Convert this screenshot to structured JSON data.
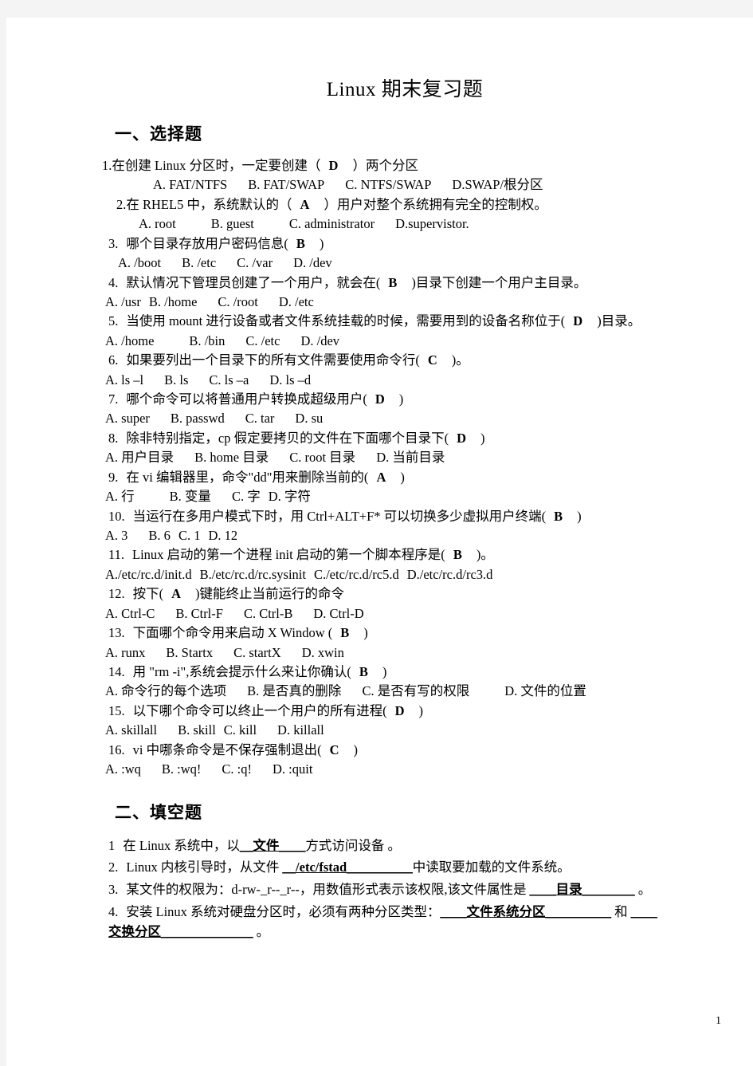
{
  "document": {
    "title": "Linux  期末复习题",
    "page_number": "1"
  },
  "sections": [
    {
      "heading": "一、选择题"
    },
    {
      "heading": "二、填空题"
    }
  ],
  "multiple_choice": [
    {
      "num": "1.",
      "stem_before": "在创建 Linux 分区时，一定要创建（",
      "answer": "D",
      "stem_after": "）两个分区",
      "options": [
        "A. FAT/NTFS",
        "B. FAT/SWAP",
        "C. NTFS/SWAP",
        "D.SWAP/根分区"
      ]
    },
    {
      "num": "2.",
      "stem_before": "在 RHEL5 中，系统默认的（",
      "answer": "A",
      "stem_after": "）用户对整个系统拥有完全的控制权。",
      "options": [
        "A. root",
        "B. guest",
        "C. administrator",
        "D.supervistor."
      ]
    },
    {
      "num": "3.",
      "stem_before": "哪个目录存放用户密码信息(",
      "answer": "B",
      "stem_after": ")",
      "options": [
        "A. /boot",
        "B. /etc",
        "C. /var",
        "D. /dev"
      ]
    },
    {
      "num": "4.",
      "stem_before": "默认情况下管理员创建了一个用户，就会在(",
      "answer": "B",
      "stem_after": ")目录下创建一个用户主目录。",
      "options": [
        "A. /usr",
        "B. /home",
        "C. /root",
        "D. /etc"
      ]
    },
    {
      "num": "5.",
      "stem_before": "当使用 mount 进行设备或者文件系统挂载的时候，需要用到的设备名称位于(",
      "answer": "D",
      "stem_after": ")目录。",
      "options": [
        "A. /home",
        "B. /bin",
        "C. /etc",
        "D. /dev"
      ]
    },
    {
      "num": "6.",
      "stem_before": "如果要列出一个目录下的所有文件需要使用命令行(",
      "answer": "C",
      "stem_after": ")。",
      "options": [
        "A. ls –l",
        "B. ls",
        "C. ls –a",
        "D. ls –d"
      ]
    },
    {
      "num": "7.",
      "stem_before": "哪个命令可以将普通用户转换成超级用户(",
      "answer": "D",
      "stem_after": ")",
      "options": [
        "A. super",
        "B. passwd",
        "C. tar",
        "D. su"
      ]
    },
    {
      "num": "8.",
      "stem_before": "除非特别指定，cp 假定要拷贝的文件在下面哪个目录下(",
      "answer": "D",
      "stem_after": ")",
      "options": [
        "A. 用户目录",
        "B. home 目录",
        "C. root 目录",
        "D. 当前目录"
      ]
    },
    {
      "num": "9.",
      "stem_before": "在 vi 编辑器里，命令\"dd\"用来删除当前的(",
      "answer": "A",
      "stem_after": ")",
      "options": [
        "A. 行",
        "B. 变量",
        "C. 字",
        "D. 字符"
      ]
    },
    {
      "num": "10.",
      "stem_before": "当运行在多用户模式下时，用 Ctrl+ALT+F* 可以切换多少虚拟用户终端(",
      "answer": "B",
      "stem_after": ")",
      "options": [
        "A. 3",
        "B. 6",
        "C. 1",
        "D. 12"
      ]
    },
    {
      "num": "11.",
      "stem_before": "Linux 启动的第一个进程 init 启动的第一个脚本程序是(",
      "answer": "B",
      "stem_after": ")。",
      "options": [
        "A./etc/rc.d/init.d",
        "B./etc/rc.d/rc.sysinit",
        "C./etc/rc.d/rc5.d",
        "D./etc/rc.d/rc3.d"
      ]
    },
    {
      "num": "12.",
      "stem_before": "按下(",
      "answer": "A",
      "stem_after": ")键能终止当前运行的命令",
      "options": [
        "A. Ctrl-C",
        "B. Ctrl-F",
        "C. Ctrl-B",
        "D. Ctrl-D"
      ]
    },
    {
      "num": "13.",
      "stem_before": "下面哪个命令用来启动 X Window (",
      "answer": "B",
      "stem_after": ")",
      "options": [
        "A. runx",
        "B. Startx",
        "C. startX",
        "D. xwin"
      ]
    },
    {
      "num": "14.",
      "stem_before": "用 \"rm -i\",系统会提示什么来让你确认(",
      "answer": "B",
      "stem_after": ")",
      "options": [
        "A. 命令行的每个选项",
        "B. 是否真的删除",
        "C. 是否有写的权限",
        "D. 文件的位置"
      ]
    },
    {
      "num": "15.",
      "stem_before": "以下哪个命令可以终止一个用户的所有进程(",
      "answer": "D",
      "stem_after": ")",
      "options": [
        "A. skillall",
        "B. skill",
        "C. kill",
        "D. killall"
      ]
    },
    {
      "num": "16.",
      "stem_before": "vi 中哪条命令是不保存强制退出(",
      "answer": "C",
      "stem_after": ")",
      "options": [
        "A. :wq",
        "B. :wq!",
        "C. :q!",
        "D. :quit"
      ]
    }
  ],
  "fill_in_blanks": [
    {
      "num": "1",
      "before": "在 Linux 系统中，以",
      "blank": "＿文件＿＿",
      "after": "方式访问设备 。"
    },
    {
      "num": "2.",
      "before": "Linux 内核引导时，从文件 ",
      "blank": "＿/etc/fstad＿＿＿＿＿",
      "after": "中读取要加载的文件系统。"
    },
    {
      "num": "3.",
      "before": "某文件的权限为：d-rw-_r--_r--，用数值形式表示该权限,该文件属性是 ",
      "blank": "＿＿目录＿＿＿＿",
      "after": " 。"
    },
    {
      "num": "4.",
      "before": "安装 Linux 系统对硬盘分区时，必须有两种分区类型：",
      "blank": "＿＿文件系统分区＿＿＿＿＿",
      "middle": " 和 ",
      "blank2": "＿＿交换分区＿＿＿＿＿＿＿",
      "after": " 。"
    }
  ]
}
